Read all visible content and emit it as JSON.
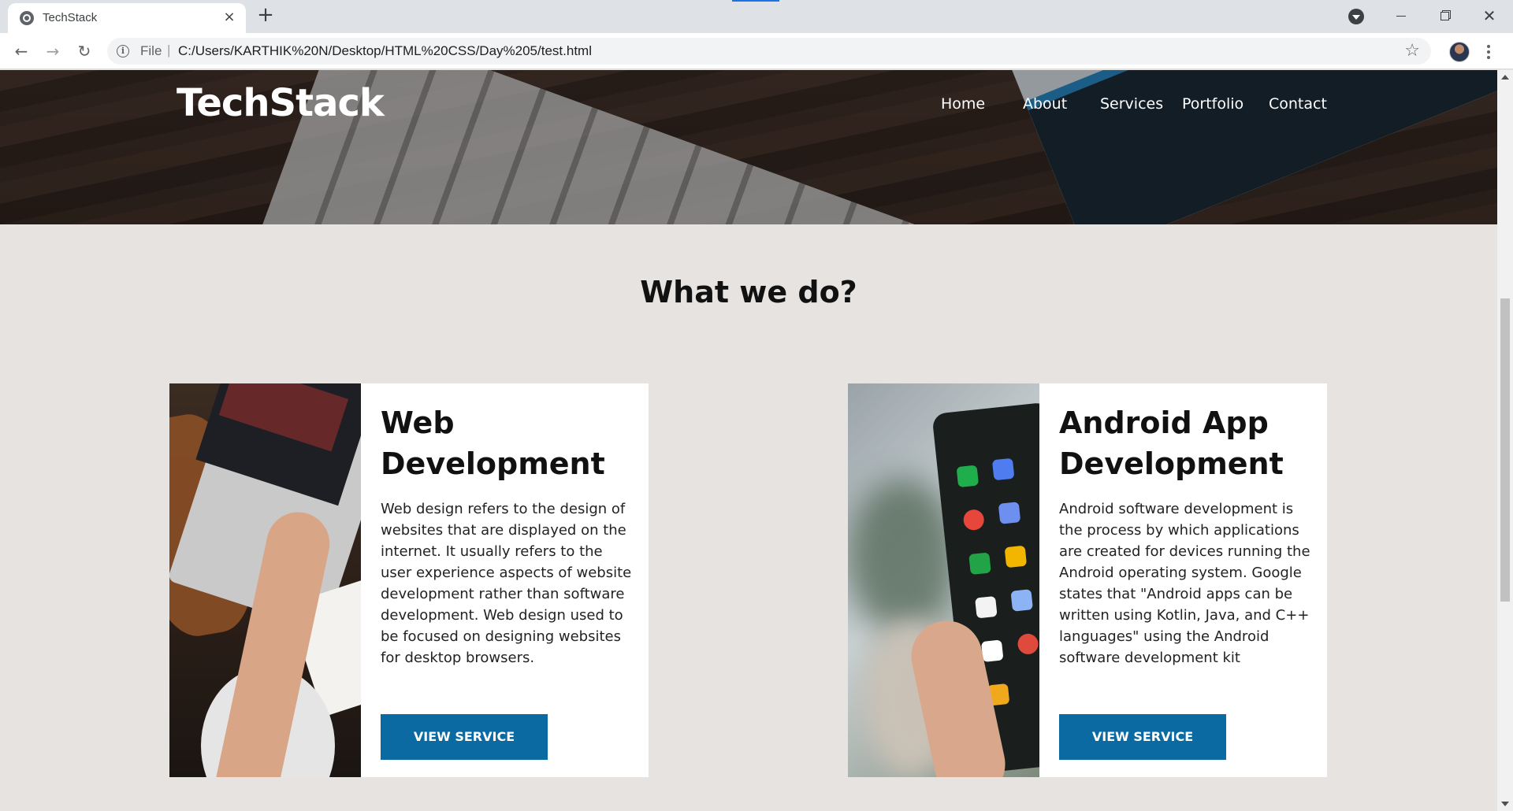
{
  "browser": {
    "tab_title": "TechStack",
    "tab_close": "×",
    "new_tab": "+",
    "scheme_label": "File",
    "url": "C:/Users/KARTHIK%20N/Desktop/HTML%20CSS/Day%205/test.html",
    "icons": [
      "globe-icon",
      "back-icon",
      "forward-icon",
      "reload-icon",
      "info-icon",
      "star-icon",
      "menu-icon"
    ]
  },
  "site": {
    "brand": "TechStack",
    "nav": [
      "Home",
      "About",
      "Services",
      "Portfolio",
      "Contact"
    ]
  },
  "section": {
    "title": "What we do?"
  },
  "services": [
    {
      "title_line1": "Web",
      "title_line2": "Development",
      "text": "Web design refers to the design of websites that are displayed on the internet. It usually refers to the user experience aspects of website development rather than software development. Web design used to be focused on designing websites for desktop browsers.",
      "button": "VIEW SERVICE"
    },
    {
      "title_line1": "Android App",
      "title_line2": "Development",
      "text": "Android software development is the process by which applications are created for devices running the Android operating system. Google states that \"Android apps can be written using Kotlin, Java, and C++ languages\" using the Android software development kit",
      "button": "VIEW SERVICE"
    }
  ],
  "colors": {
    "button": "#0a6aa1",
    "page_bg": "#e6e3e1",
    "card_bg": "#ffffff"
  }
}
